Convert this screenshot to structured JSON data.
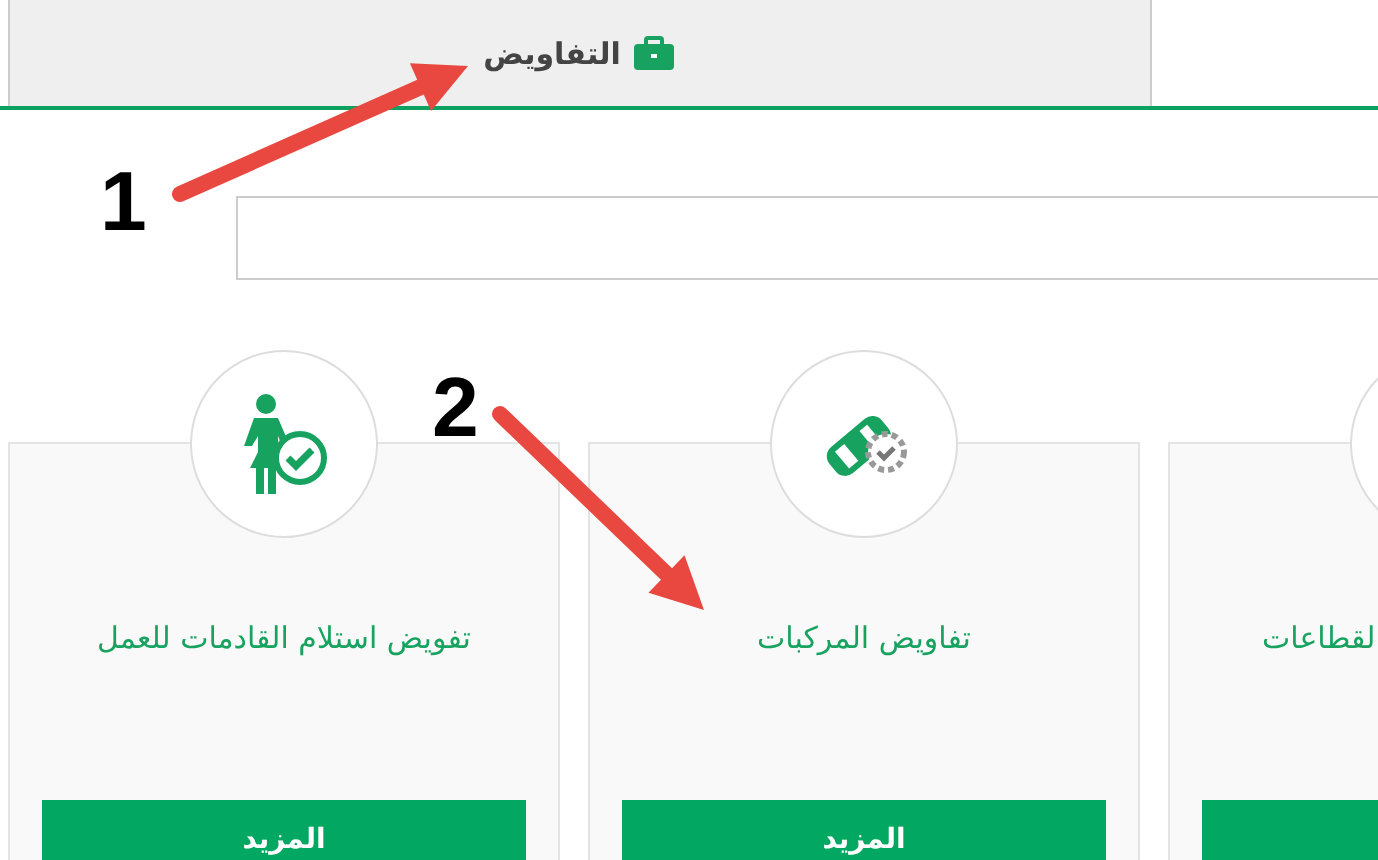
{
  "tabs": [
    {
      "label": "التفاويض",
      "selected": true
    }
  ],
  "cards": [
    {
      "title": "لقطاعات"
    },
    {
      "title": "تفاويض المركبات",
      "button": "المزيد"
    },
    {
      "title": "تفويض استلام القادمات للعمل",
      "button": "المزيد"
    }
  ],
  "annotations": [
    {
      "label": "1"
    },
    {
      "label": "2"
    }
  ]
}
